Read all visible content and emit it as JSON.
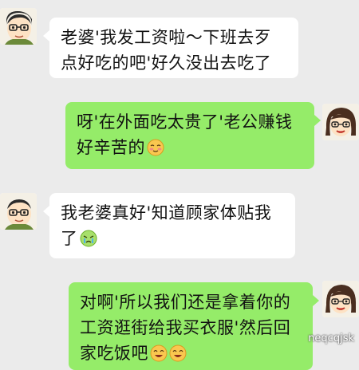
{
  "messages": [
    {
      "side": "left",
      "lines": [
        "老婆'我发工资啦～下班去歹",
        "点好吃的吧'好久没出去吃了"
      ],
      "emoji": ""
    },
    {
      "side": "right",
      "lines": [
        "呀'在外面吃太贵了'老公赚钱",
        "好辛苦的"
      ],
      "emoji": "blushing-face-emoji"
    },
    {
      "side": "left",
      "lines": [
        "我老婆真好'知道顾家体贴我",
        "了"
      ],
      "emoji": "crying-face-emoji"
    },
    {
      "side": "right",
      "lines": [
        "对啊'所以我们还是拿着你的",
        "工资逛街给我买衣服'然后回",
        "家吃饭吧"
      ],
      "emoji": "laughing-faces-emoji"
    }
  ],
  "watermark": "neqcqjsk"
}
